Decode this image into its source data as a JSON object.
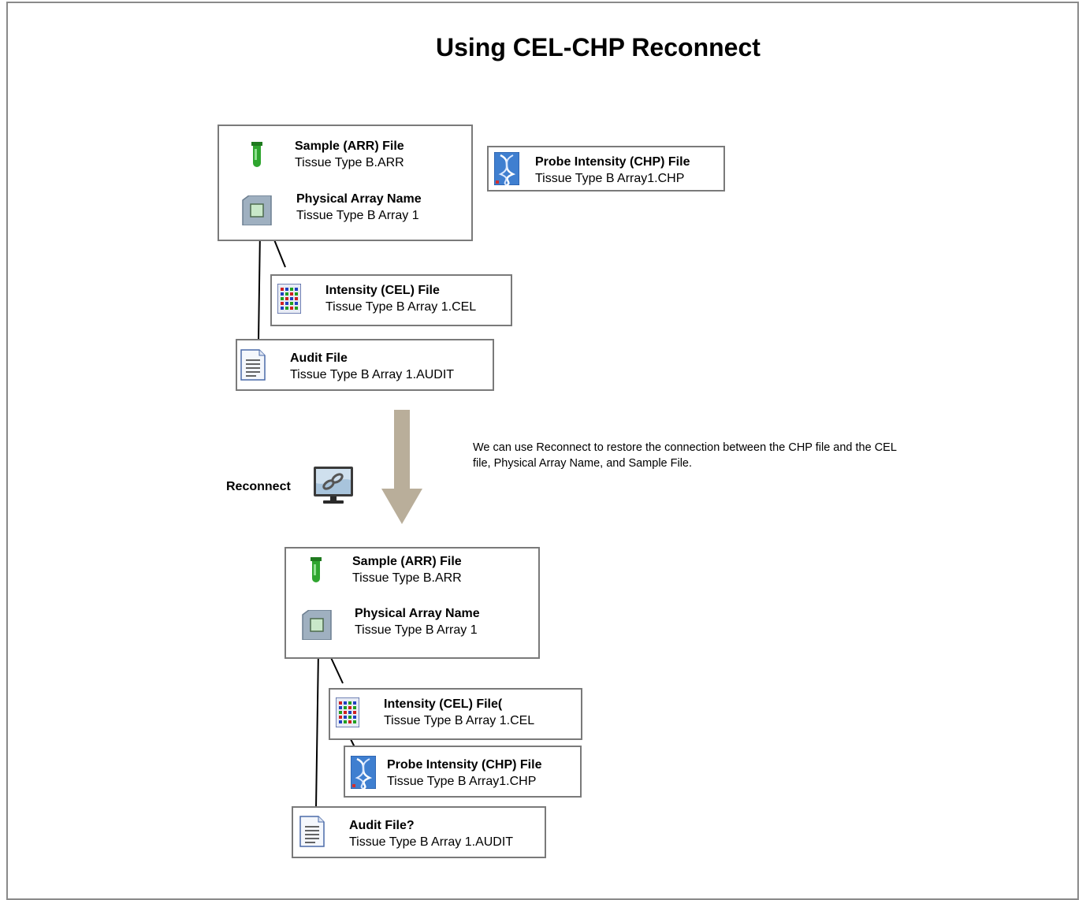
{
  "title": "Using CEL-CHP Reconnect",
  "before": {
    "sample": {
      "title": "Sample (ARR) File",
      "subtitle": "Tissue Type B.ARR",
      "icon": "test-tube-icon"
    },
    "array": {
      "title": "Physical Array Name",
      "subtitle": "Tissue Type B Array 1",
      "icon": "array-chip-icon"
    },
    "cel": {
      "title": "Intensity (CEL) File",
      "subtitle": "Tissue Type B Array 1.CEL",
      "icon": "cel-grid-icon"
    },
    "audit": {
      "title": "Audit File",
      "subtitle": "Tissue Type B Array 1.AUDIT",
      "icon": "document-icon"
    },
    "chp": {
      "title": "Probe Intensity (CHP) File",
      "subtitle": "Tissue  Type B Array1.CHP",
      "icon": "dna-icon"
    }
  },
  "note": "We can use Reconnect to restore the connection  between the CHP file and the CEL file, Physical Array Name, and Sample File.",
  "reconnect": {
    "label": "Reconnect",
    "icon": "reconnect-monitor-icon"
  },
  "arrow_color": "#b9ae9a",
  "after": {
    "sample": {
      "title": "Sample (ARR) File",
      "subtitle": "Tissue Type B.ARR"
    },
    "array": {
      "title": "Physical Array Name",
      "subtitle": "Tissue Type B Array 1"
    },
    "cel": {
      "title": "Intensity (CEL) File(",
      "subtitle": "Tissue Type B Array 1.CEL"
    },
    "chp": {
      "title": "Probe Intensity (CHP) File",
      "subtitle": "Tissue  Type B Array1.CHP"
    },
    "audit": {
      "title": "Audit File?",
      "subtitle": "Tissue Type B Array 1.AUDIT"
    }
  }
}
